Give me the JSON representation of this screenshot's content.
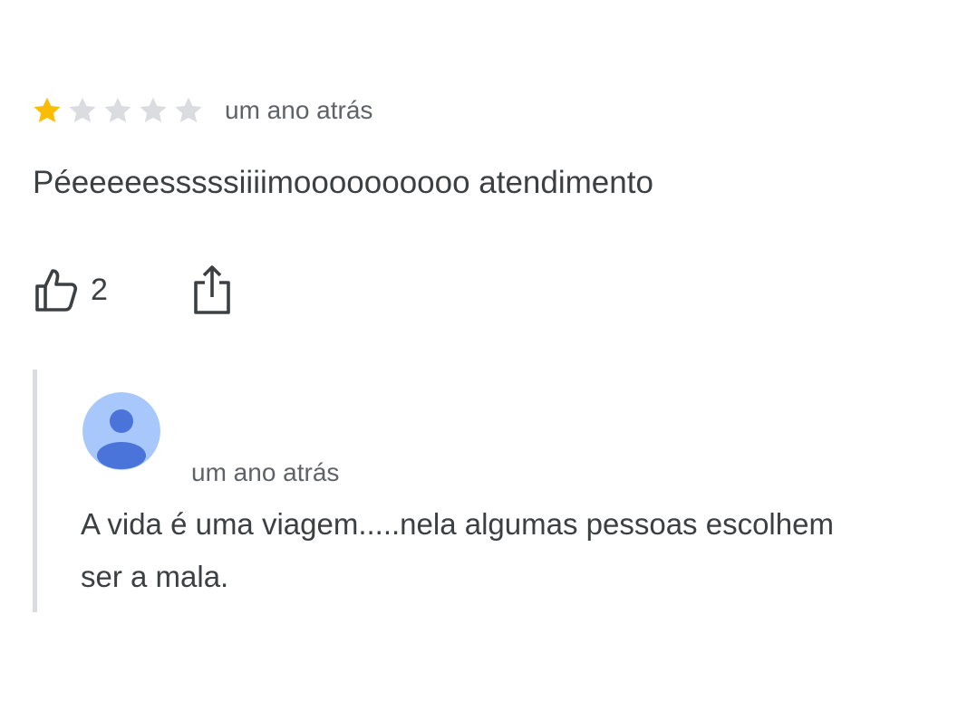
{
  "review": {
    "rating": 1,
    "max_rating": 5,
    "time": "um ano atrás",
    "text": "Péeeeeesssssiiiimoooooooooo atendimento",
    "like_count": "2",
    "colors": {
      "star_filled": "#fbbc04",
      "star_empty": "#dadce0",
      "text": "#3c4043",
      "muted": "#5f6368"
    }
  },
  "reply": {
    "time": "um ano atrás",
    "text": "A vida é uma viagem.....nela algumas pessoas escolhem ser a mala.",
    "avatar_icon": "person-avatar-icon",
    "avatar_colors": {
      "background": "#a8c7fa",
      "figure": "#4a74d9"
    }
  }
}
